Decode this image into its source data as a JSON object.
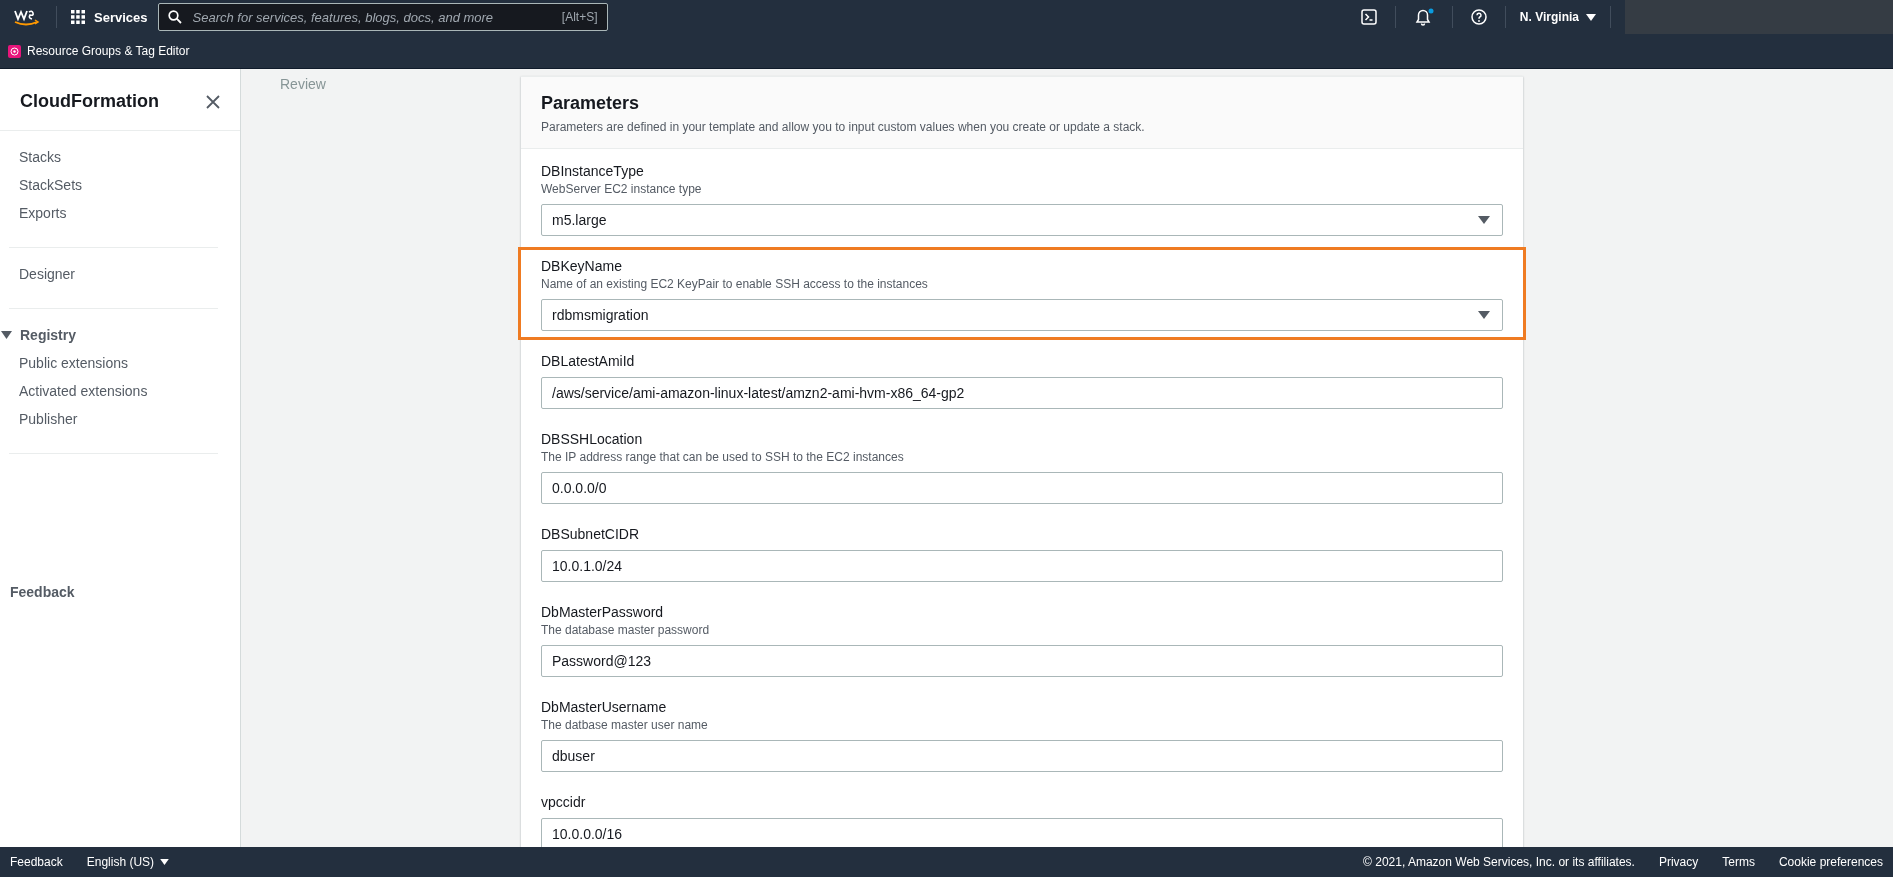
{
  "top_nav": {
    "services_label": "Services",
    "search_placeholder": "Search for services, features, blogs, docs, and more",
    "search_shortcut": "[Alt+S]",
    "notification_unread": true,
    "region": "N. Virginia"
  },
  "favorites_bar": {
    "items": [
      "Resource Groups & Tag Editor"
    ]
  },
  "sidebar": {
    "title": "CloudFormation",
    "sections": [
      {
        "items": [
          {
            "label": "Stacks"
          },
          {
            "label": "StackSets"
          },
          {
            "label": "Exports"
          }
        ]
      },
      {
        "items": [
          {
            "label": "Designer"
          }
        ]
      },
      {
        "heading": "Registry",
        "expanded": true,
        "items": [
          {
            "label": "Public extensions"
          },
          {
            "label": "Activated extensions"
          },
          {
            "label": "Publisher"
          }
        ]
      }
    ],
    "feedback": "Feedback"
  },
  "steps": {
    "current_label": "Review"
  },
  "parameters_panel": {
    "title": "Parameters",
    "description": "Parameters are defined in your template and allow you to input custom values when you create or update a stack.",
    "parameters": [
      {
        "name": "DBInstanceType",
        "description": "WebServer EC2 instance type",
        "kind": "select",
        "value": "m5.large",
        "highlighted": false
      },
      {
        "name": "DBKeyName",
        "description": "Name of an existing EC2 KeyPair to enable SSH access to the instances",
        "kind": "select",
        "value": "rdbmsmigration",
        "highlighted": true
      },
      {
        "name": "DBLatestAmiId",
        "kind": "text",
        "value": "/aws/service/ami-amazon-linux-latest/amzn2-ami-hvm-x86_64-gp2",
        "highlighted": false
      },
      {
        "name": "DBSSHLocation",
        "description": "The IP address range that can be used to SSH to the EC2 instances",
        "kind": "text",
        "value": "0.0.0.0/0",
        "highlighted": false
      },
      {
        "name": "DBSubnetCIDR",
        "kind": "text",
        "value": "10.0.1.0/24",
        "highlighted": false
      },
      {
        "name": "DbMasterPassword",
        "description": "The database master password",
        "kind": "text",
        "value": "Password@123",
        "highlighted": false
      },
      {
        "name": "DbMasterUsername",
        "description": "The datbase master user name",
        "kind": "text",
        "value": "dbuser",
        "highlighted": false
      },
      {
        "name": "vpccidr",
        "kind": "text",
        "value": "10.0.0.0/16",
        "highlighted": false
      }
    ]
  },
  "footer": {
    "feedback": "Feedback",
    "language": "English (US)",
    "copyright": "© 2021, Amazon Web Services, Inc. or its affiliates.",
    "links": [
      "Privacy",
      "Terms",
      "Cookie preferences"
    ]
  }
}
